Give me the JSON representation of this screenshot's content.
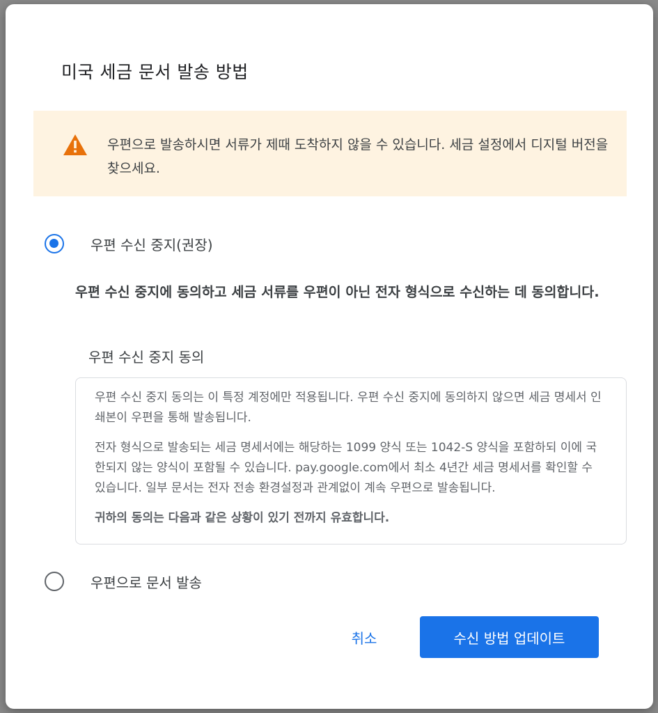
{
  "dialog": {
    "title": "미국 세금 문서 발송 방법",
    "warning": {
      "icon": "warning-triangle-icon",
      "text": "우편으로 발송하시면 서류가 제때 도착하지 않을 수 있습니다. 세금 설정에서 디지털 버전을 찾으세요."
    },
    "options": [
      {
        "label": "우편 수신 중지(권장)",
        "selected": true
      },
      {
        "label": "우편으로 문서 발송",
        "selected": false
      }
    ],
    "agree_text": "우편 수신 중지에 동의하고 세금 서류를 우편이 아닌 전자 형식으로 수신하는 데 동의합니다.",
    "consent": {
      "title": "우편 수신 중지 동의",
      "paragraphs": [
        "우편 수신 중지 동의는 이 특정 계정에만 적용됩니다.  우편 수신 중지에 동의하지 않으면 세금 명세서 인쇄본이 우편을 통해 발송됩니다.",
        "전자 형식으로 발송되는 세금 명세서에는 해당하는 1099 양식 또는 1042-S 양식을 포함하되 이에 국한되지 않는 양식이 포함될 수 있습니다. pay.google.com에서 최소 4년간 세금 명세서를 확인할 수 있습니다. 일부 문서는 전자 전송 환경설정과 관계없이 계속 우편으로 발송됩니다.",
        "귀하의 동의는 다음과 같은 상황이 있기 전까지 유효합니다."
      ]
    },
    "buttons": {
      "cancel": "취소",
      "update": "수신 방법 업데이트"
    },
    "colors": {
      "accent": "#1a73e8",
      "warning_bg": "#fef3e1",
      "warning_icon": "#e8710a"
    }
  }
}
